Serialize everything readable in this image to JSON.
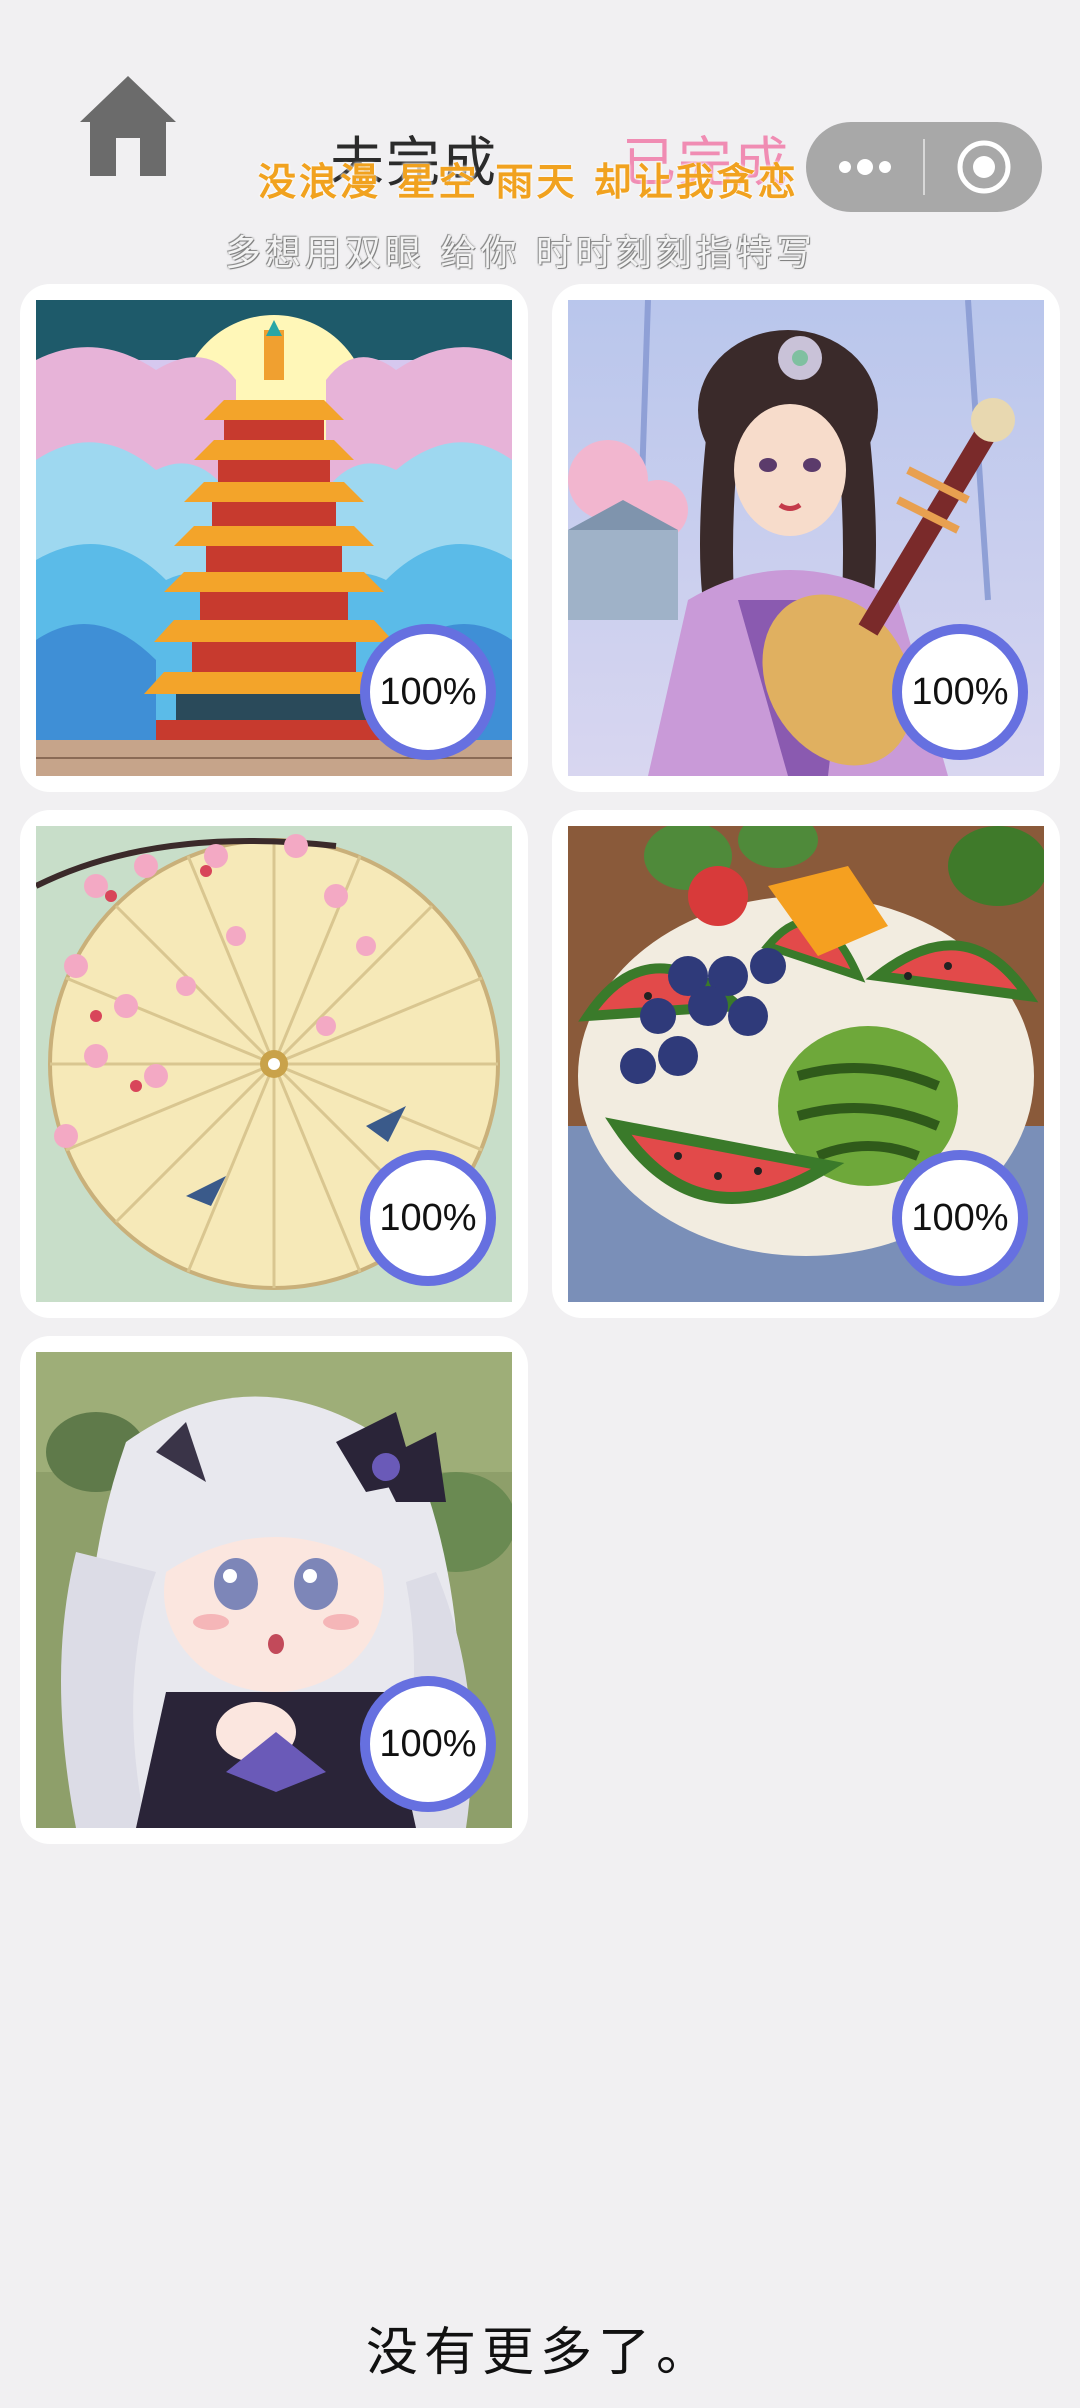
{
  "header": {
    "tabs": [
      "未完成",
      "已完成"
    ],
    "slogan_line1": "没浪漫 星空 雨天 却让我贪恋",
    "slogan_line2": "多想用双眼 给你 时时刻刻指特写"
  },
  "capsule": {
    "menu_icon": "more-dots-icon",
    "close_icon": "target-circle-icon"
  },
  "artworks": [
    {
      "subject": "pagoda",
      "progress_label": "100%",
      "progress": 1.0
    },
    {
      "subject": "pipa-lady",
      "progress_label": "100%",
      "progress": 1.0
    },
    {
      "subject": "paper-umbrella",
      "progress_label": "100%",
      "progress": 1.0
    },
    {
      "subject": "fruit-plate",
      "progress_label": "100%",
      "progress": 1.0
    },
    {
      "subject": "anime-girl",
      "progress_label": "100%",
      "progress": 1.0
    }
  ],
  "footer": {
    "end_message": "没有更多了。"
  },
  "colors": {
    "background": "#f1f0f2",
    "badge_ring": "#6670e0",
    "tab_unfinished": "#2b2b2b",
    "tab_finished": "#f08cb3",
    "slogan_yellow": "#f1a21f"
  }
}
